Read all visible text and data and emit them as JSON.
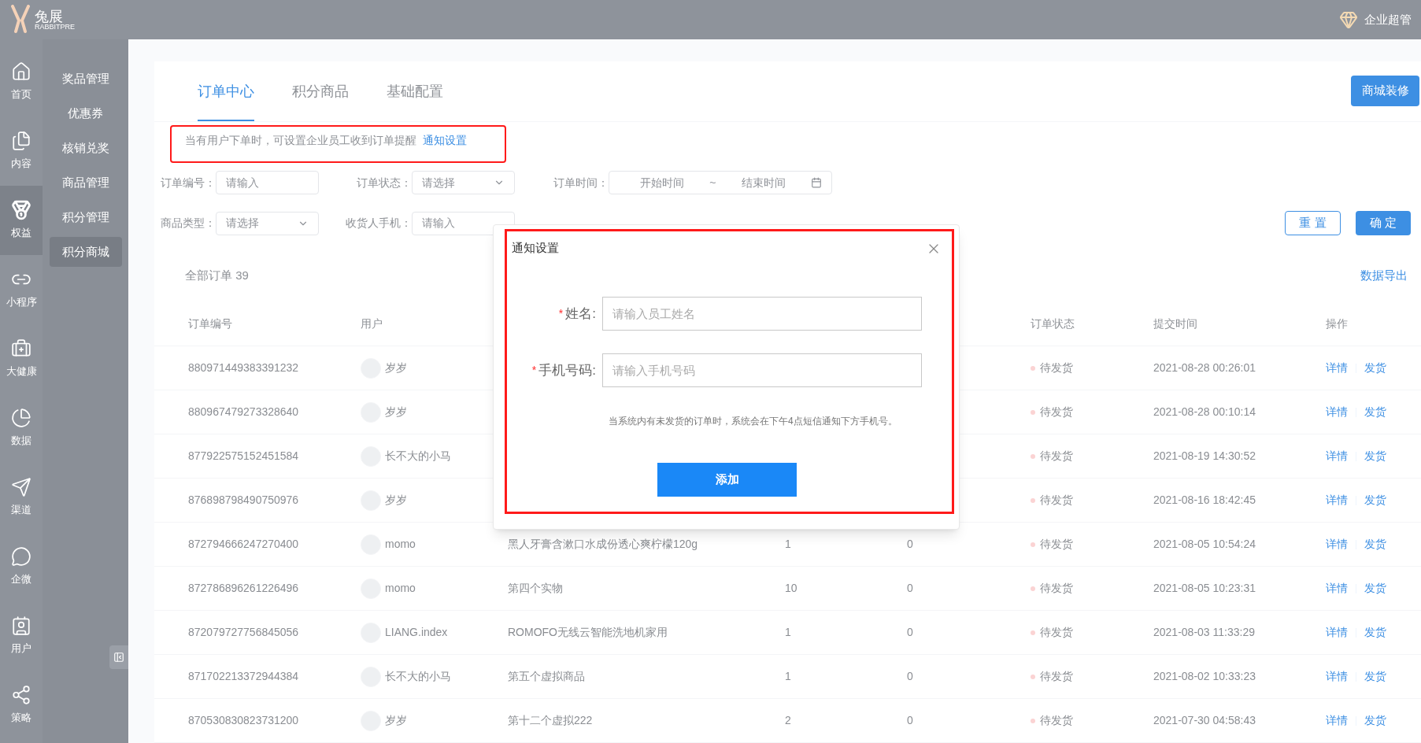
{
  "topbar": {
    "logo": {
      "name": "兔展",
      "subtitle": "RABBITPRE"
    },
    "user_label": "企业超管"
  },
  "rail": [
    {
      "label": "首页",
      "selected": false
    },
    {
      "label": "内容",
      "selected": false
    },
    {
      "label": "权益",
      "selected": true
    },
    {
      "label": "小程序",
      "selected": false
    },
    {
      "label": "大健康",
      "selected": false
    },
    {
      "label": "数据",
      "selected": false
    },
    {
      "label": "渠道",
      "selected": false
    },
    {
      "label": "企微",
      "selected": false
    },
    {
      "label": "用户",
      "selected": false
    },
    {
      "label": "策略",
      "selected": false
    }
  ],
  "submenu": [
    {
      "label": "奖品管理",
      "selected": false
    },
    {
      "label": "优惠券",
      "selected": false
    },
    {
      "label": "核销兑奖",
      "selected": false
    },
    {
      "label": "商品管理",
      "selected": false
    },
    {
      "label": "积分管理",
      "selected": false
    },
    {
      "label": "积分商城",
      "selected": true
    }
  ],
  "tabs": [
    {
      "label": "订单中心",
      "selected": true
    },
    {
      "label": "积分商品",
      "selected": false
    },
    {
      "label": "基础配置",
      "selected": false
    }
  ],
  "shop_button": "商城装修",
  "notice": {
    "text": "当有用户下单时，可设置企业员工收到订单提醒",
    "link": "通知设置"
  },
  "filters": [
    [
      {
        "label": "订单编号：",
        "kind": "input",
        "placeholder": "请输入"
      },
      {
        "label": "订单状态：",
        "kind": "select",
        "placeholder": "请选择"
      },
      {
        "label": "订单时间：",
        "kind": "range",
        "start": "开始时间",
        "separator": "~",
        "end": "结束时间"
      }
    ],
    [
      {
        "label": "商品类型：",
        "kind": "select",
        "placeholder": "请选择"
      },
      {
        "label": "收货人手机：",
        "kind": "input",
        "placeholder": "请输入"
      }
    ]
  ],
  "filter_buttons": {
    "reset": "重 置",
    "confirm": "确 定"
  },
  "summary": "全部订单 39",
  "export": "数据导出",
  "table": {
    "columns": {
      "order_no": "订单编号",
      "user": "用户",
      "status": "订单状态",
      "time": "提交时间",
      "actions": "操作"
    },
    "rows": [
      {
        "order_no": "880971449383391232",
        "user": "岁岁",
        "status": "待发货",
        "time": "2021-08-28 00:26:01",
        "actions": [
          "详情",
          "发货"
        ]
      },
      {
        "order_no": "880967479273328640",
        "user": "岁岁",
        "status": "待发货",
        "time": "2021-08-28 00:10:14",
        "actions": [
          "详情",
          "发货"
        ]
      },
      {
        "order_no": "877922575152451584",
        "user": "长不大的小马",
        "status": "待发货",
        "time": "2021-08-19 14:30:52",
        "actions": [
          "详情",
          "发货"
        ]
      },
      {
        "order_no": "876898798490750976",
        "user": "岁岁",
        "status": "待发货",
        "time": "2021-08-16 18:42:45",
        "actions": [
          "详情",
          "发货"
        ]
      },
      {
        "order_no": "872794666247270400",
        "user": "momo",
        "product": "黑人牙膏含漱口水成份透心爽柠檬120g",
        "qty": "1",
        "points": "0",
        "status": "待发货",
        "time": "2021-08-05 10:54:24",
        "actions": [
          "详情",
          "发货"
        ]
      },
      {
        "order_no": "872786896261226496",
        "user": "momo",
        "product": "第四个实物",
        "qty": "10",
        "points": "0",
        "status": "待发货",
        "time": "2021-08-05 10:23:31",
        "actions": [
          "详情",
          "发货"
        ]
      },
      {
        "order_no": "872079727756845056",
        "user": "LIANG.index",
        "product": "ROMOFO无线云智能洗地机家用",
        "qty": "1",
        "points": "0",
        "status": "待发货",
        "time": "2021-08-03 11:33:29",
        "actions": [
          "详情",
          "发货"
        ]
      },
      {
        "order_no": "871702213372944384",
        "user": "长不大的小马",
        "product": "第五个虚拟商品",
        "qty": "1",
        "points": "0",
        "status": "待发货",
        "time": "2021-08-02 10:33:23",
        "actions": [
          "详情",
          "发货"
        ]
      },
      {
        "order_no": "870530830823731200",
        "user": "岁岁",
        "product": "第十二个虚拟222",
        "qty": "2",
        "points": "0",
        "status": "待发货",
        "time": "2021-07-30 04:58:43",
        "actions": [
          "详情",
          "发货"
        ]
      }
    ]
  },
  "modal": {
    "title": "通知设置",
    "fields": [
      {
        "required_mark": "*",
        "label": "姓名:",
        "placeholder": "请输入员工姓名"
      },
      {
        "required_mark": "*",
        "label": "手机号码:",
        "placeholder": "请输入手机号码"
      }
    ],
    "hint": "当系统内有未发货的订单时，系统会在下午4点短信通知下方手机号。",
    "submit": "添加"
  }
}
